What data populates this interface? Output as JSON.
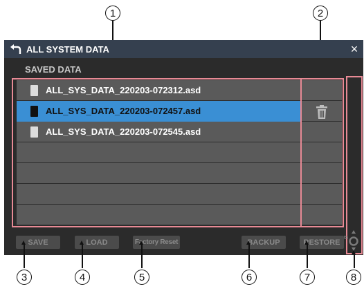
{
  "window": {
    "title": "ALL SYSTEM DATA",
    "back_icon": "back-arrow-icon",
    "close_icon": "close-icon",
    "close_symbol": "×"
  },
  "section_label": "SAVED DATA",
  "files": [
    {
      "name": "ALL_SYS_DATA_220203-072312.asd",
      "selected": false
    },
    {
      "name": "ALL_SYS_DATA_220203-072457.asd",
      "selected": true
    },
    {
      "name": "ALL_SYS_DATA_220203-072545.asd",
      "selected": false
    }
  ],
  "delete_icon": "trash-icon",
  "buttons": {
    "save": "SAVE",
    "load": "LOAD",
    "factory_reset": "Factory Reset",
    "backup": "BACKUP",
    "restore": "RESTORE",
    "restore_ext_mark": "⧉"
  },
  "callouts": [
    "1",
    "2",
    "3",
    "4",
    "5",
    "6",
    "7",
    "8"
  ],
  "colors": {
    "title_bar": "#35404f",
    "selected_row": "#3a8fd4",
    "row": "#5a5a5a",
    "highlight": "#e88a95",
    "background": "#2b2b2b"
  }
}
